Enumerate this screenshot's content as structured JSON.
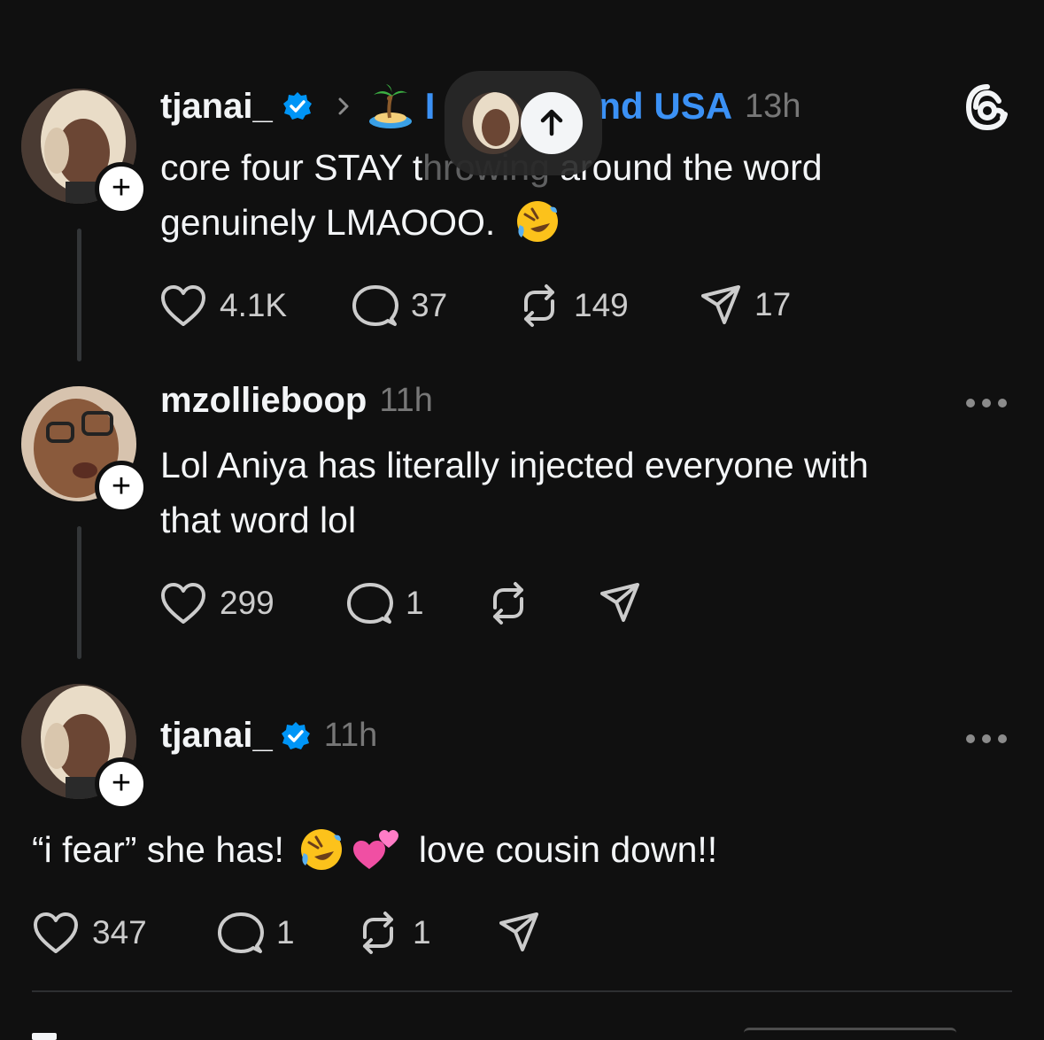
{
  "app": "Threads",
  "posts": [
    {
      "username": "tjanai_",
      "verified": true,
      "community_prefix": "I",
      "community_suffix": "nd USA",
      "time": "13h",
      "text_line1_a": "core four STAY t",
      "text_line1_hidden": "hrowing",
      "text_line1_b": " around the word",
      "text_line2": "genuinely LMAOOO.",
      "likes": "4.1K",
      "replies": "37",
      "reposts": "149",
      "shares": "17"
    },
    {
      "username": "mzollieboop",
      "verified": false,
      "time": "11h",
      "text_line1": "Lol Aniya has literally injected everyone with",
      "text_line2": "that word lol",
      "likes": "299",
      "replies": "1"
    },
    {
      "username": "tjanai_",
      "verified": true,
      "time": "11h",
      "text_a": "“i fear” she has!",
      "text_b": "love cousin down!!",
      "likes": "347",
      "replies": "1",
      "reposts": "1"
    }
  ],
  "colors": {
    "background": "#101010",
    "verified": "#0095f6",
    "community_link": "#3b91f5"
  },
  "icons": [
    "threads-logo-icon",
    "chevron-right-icon",
    "island-emoji",
    "rofl-emoji",
    "two-hearts-emoji",
    "heart-icon",
    "reply-icon",
    "repost-icon",
    "share-icon",
    "more-icon",
    "scroll-up-icon",
    "plus-icon",
    "verified-badge-icon"
  ]
}
